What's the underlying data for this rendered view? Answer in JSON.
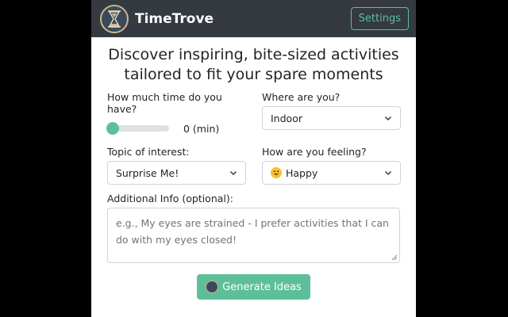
{
  "app": {
    "name": "TimeTrove"
  },
  "nav": {
    "settings_label": "Settings"
  },
  "heading": {
    "line1": "Discover inspiring, bite-sized activities",
    "line2": "tailored to fit your spare moments"
  },
  "form": {
    "time": {
      "label": "How much time do you have?",
      "value_text": "0 (min)",
      "slider_fraction": 0
    },
    "location": {
      "label": "Where are you?",
      "selected": "Indoor"
    },
    "topic": {
      "label": "Topic of interest:",
      "selected": "Surprise Me!"
    },
    "feeling": {
      "label": "How are you feeling?",
      "selected": "Happy",
      "icon": "smiley-face-icon"
    },
    "additional": {
      "label": "Additional Info (optional):",
      "placeholder": "e.g., My eyes are strained - I prefer activities that I can do with my eyes closed!"
    },
    "generate_label": "Generate Ideas"
  },
  "colors": {
    "accent": "#5dbf9a",
    "navbar": "#343a40",
    "emoji": "#f7c234"
  }
}
